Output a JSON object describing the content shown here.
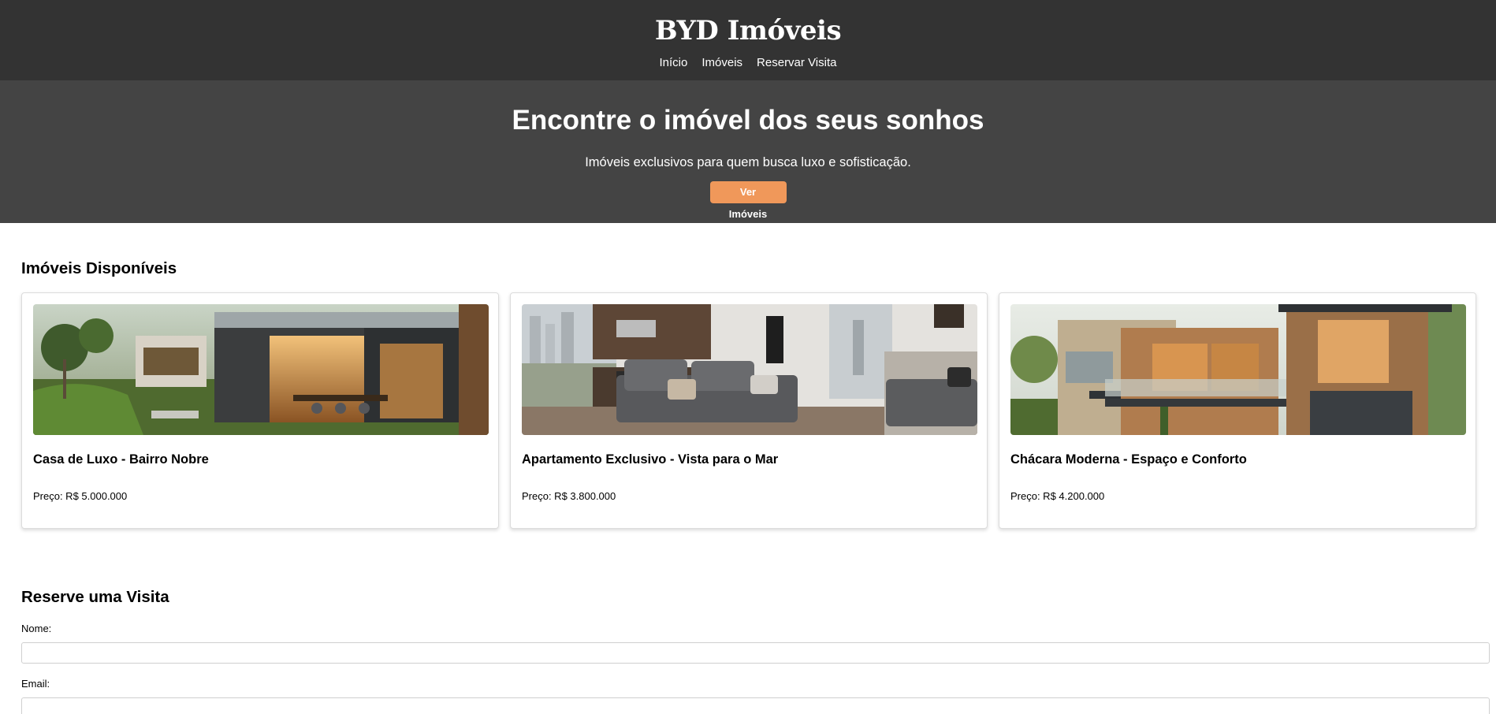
{
  "header": {
    "brand": "BYD Imóveis",
    "nav": [
      "Início",
      "Imóveis",
      "Reservar Visita"
    ]
  },
  "hero": {
    "title": "Encontre o imóvel dos seus sonhos",
    "subtitle": "Imóveis exclusivos para quem busca luxo e sofisticação.",
    "button_label": "Ver Imóveis"
  },
  "listings": {
    "title": "Imóveis Disponíveis",
    "cards": [
      {
        "title": "Casa de Luxo - Bairro Nobre",
        "price": "Preço: R$ 5.000.000",
        "image": "luxury-house-photo"
      },
      {
        "title": "Apartamento Exclusivo - Vista para o Mar",
        "price": "Preço: R$ 3.800.000",
        "image": "apartment-living-room-photo"
      },
      {
        "title": "Chácara Moderna - Espaço e Conforto",
        "price": "Preço: R$ 4.200.000",
        "image": "modern-house-facade-photo"
      }
    ]
  },
  "visit_form": {
    "title": "Reserve uma Visita",
    "name_label": "Nome:",
    "name_value": "",
    "email_label": "Email:",
    "email_value": ""
  },
  "colors": {
    "header_bg": "#333333",
    "hero_bg": "#444444",
    "accent": "#f0985a"
  }
}
